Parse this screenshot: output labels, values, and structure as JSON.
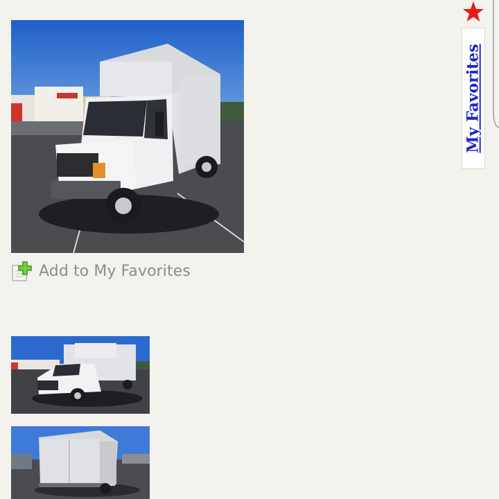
{
  "gallery": {
    "main_image_icon": "box-truck-photo",
    "thumbnails": [
      "box-truck-front-photo",
      "box-truck-rear-photo"
    ]
  },
  "favorites_action": {
    "label": "Add to My Favorites",
    "icon": "add-favorite-icon"
  },
  "side_tab": {
    "label": "My Favorites",
    "icon": "star-icon",
    "color": "#1f24c9",
    "star_color": "#e31b1b"
  }
}
